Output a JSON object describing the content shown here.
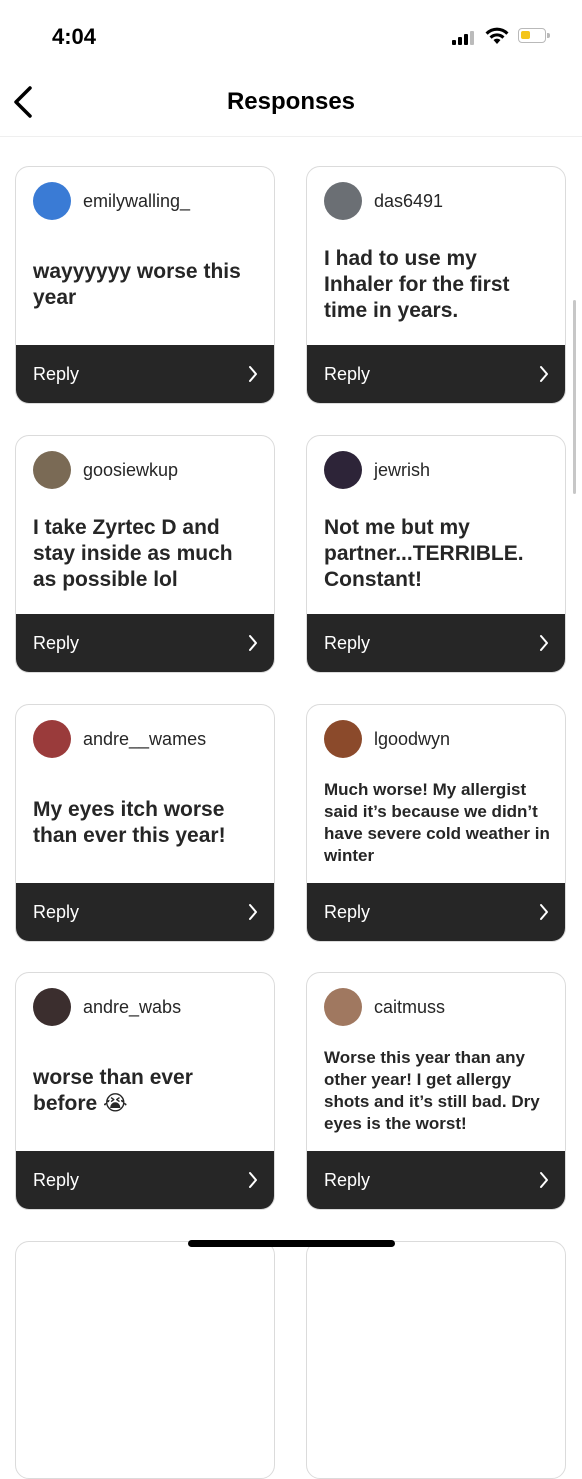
{
  "status_bar": {
    "time": "4:04"
  },
  "header": {
    "title": "Responses"
  },
  "responses": [
    {
      "username": "emilywalling_",
      "text": "wayyyyyy worse this year",
      "reply_label": "Reply",
      "avatar_color": "#3a7bd5"
    },
    {
      "username": "das6491",
      "text": "I had to use my Inhaler for the first time in years.",
      "reply_label": "Reply",
      "avatar_color": "#6b6f74"
    },
    {
      "username": "goosiewkup",
      "text": "I take Zyrtec D and stay inside as much as possible lol",
      "reply_label": "Reply",
      "avatar_color": "#7a6a55"
    },
    {
      "username": "jewrish",
      "text": "Not me but my partner...TERRIBLE. Constant!",
      "reply_label": "Reply",
      "avatar_color": "#2d2438"
    },
    {
      "username": "andre__wames",
      "text": "My eyes itch worse than ever this year!",
      "reply_label": "Reply",
      "avatar_color": "#9a3b3b"
    },
    {
      "username": "lgoodwyn",
      "text": "Much worse! My allergist said it’s because we didn’t have severe cold weather in winter",
      "reply_label": "Reply",
      "avatar_color": "#8b4a2b"
    },
    {
      "username": "andre_wabs",
      "text": "worse than ever before 😭",
      "reply_label": "Reply",
      "avatar_color": "#3b2e2e"
    },
    {
      "username": "caitmuss",
      "text": "Worse this year than any other year! I get allergy shots and it’s still bad. Dry eyes is the worst!",
      "reply_label": "Reply",
      "avatar_color": "#a07860"
    }
  ]
}
